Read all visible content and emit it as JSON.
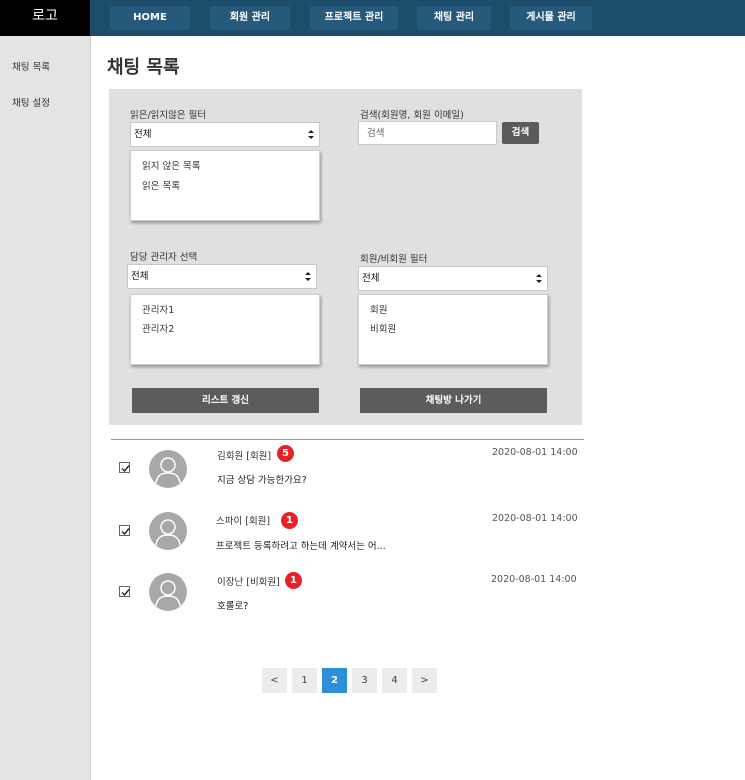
{
  "app": {
    "logo": "로고"
  },
  "nav": {
    "tabs": [
      {
        "label": "HOME"
      },
      {
        "label": "회원 관리"
      },
      {
        "label": "프로젝트 관리"
      },
      {
        "label": "채팅 관리"
      },
      {
        "label": "게시물 관리"
      }
    ]
  },
  "sidebar": {
    "items": [
      {
        "label": "채팅 목록"
      },
      {
        "label": "채팅 설정"
      }
    ]
  },
  "page": {
    "title": "채팅 목록"
  },
  "filters": {
    "read": {
      "label": "읽은/읽지않은  필터",
      "selected": "전체",
      "options": [
        "읽지 않은 목록",
        "읽은 목록"
      ]
    },
    "search": {
      "label": "검색(회원명, 회원 이메일)",
      "placeholder": "검색",
      "button": "검색"
    },
    "manager": {
      "label": "담당 관리자  선택",
      "selected": "전체",
      "options": [
        "관리자1",
        "관리자2"
      ]
    },
    "member": {
      "label": "회원/비회원  필터",
      "selected": "전체",
      "options": [
        "회원",
        "비회원"
      ]
    },
    "refresh_button": "리스트 갱신",
    "leave_button": "채팅방 나가기"
  },
  "chats": [
    {
      "name": "김회원 [회원]",
      "unread": "5",
      "message": "지금 상담 가능한가요?",
      "date": "2020-08-01 14:00",
      "checked": true
    },
    {
      "name": "스파이 [회원]",
      "unread": "1",
      "message": "프로젝트 등록하려고 하는데 계약서는 어...",
      "date": "2020-08-01 14:00",
      "checked": true
    },
    {
      "name": "이장난 [비회원]",
      "unread": "1",
      "message": "호롤로?",
      "date": "2020-08-01 14:00",
      "checked": true
    }
  ],
  "pagination": {
    "prev": "<",
    "pages": [
      "1",
      "2",
      "3",
      "4"
    ],
    "current": "2",
    "next": ">"
  },
  "colors": {
    "topbar": "#1e4d6b",
    "badge": "#e8202a",
    "active_page": "#2d8fd6"
  }
}
